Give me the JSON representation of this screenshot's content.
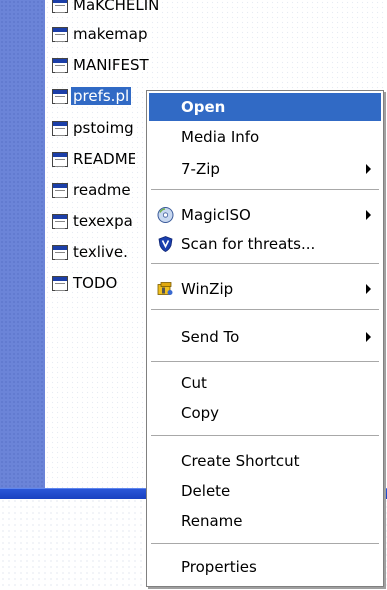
{
  "file_list": {
    "items": [
      {
        "name": "MaKCHELIN",
        "partial": true
      },
      {
        "name": "makemap"
      },
      {
        "name": "MANIFEST"
      },
      {
        "name": "prefs.pl",
        "selected": true
      },
      {
        "name": "pstoimg"
      },
      {
        "name": "README"
      },
      {
        "name": "readme"
      },
      {
        "name": "texexpa"
      },
      {
        "name": "texlive."
      },
      {
        "name": "TODO"
      }
    ]
  },
  "context_menu": {
    "items": [
      {
        "label": "Open",
        "highlight": true
      },
      {
        "label": "Media Info"
      },
      {
        "label": "7-Zip",
        "submenu": true
      },
      {
        "label": "MagicISO",
        "submenu": true,
        "icon": "magiciso-icon"
      },
      {
        "label": "Scan for threats...",
        "icon": "shield-icon"
      },
      {
        "label": "WinZip",
        "submenu": true,
        "icon": "winzip-icon"
      },
      {
        "label": "Send To",
        "submenu": true
      },
      {
        "label": "Cut"
      },
      {
        "label": "Copy"
      },
      {
        "label": "Create Shortcut"
      },
      {
        "label": "Delete"
      },
      {
        "label": "Rename"
      },
      {
        "label": "Properties"
      }
    ]
  },
  "colors": {
    "selection": "#316ac5",
    "left_pane": "#6b84d8",
    "taskbar": "#2a56d8"
  }
}
